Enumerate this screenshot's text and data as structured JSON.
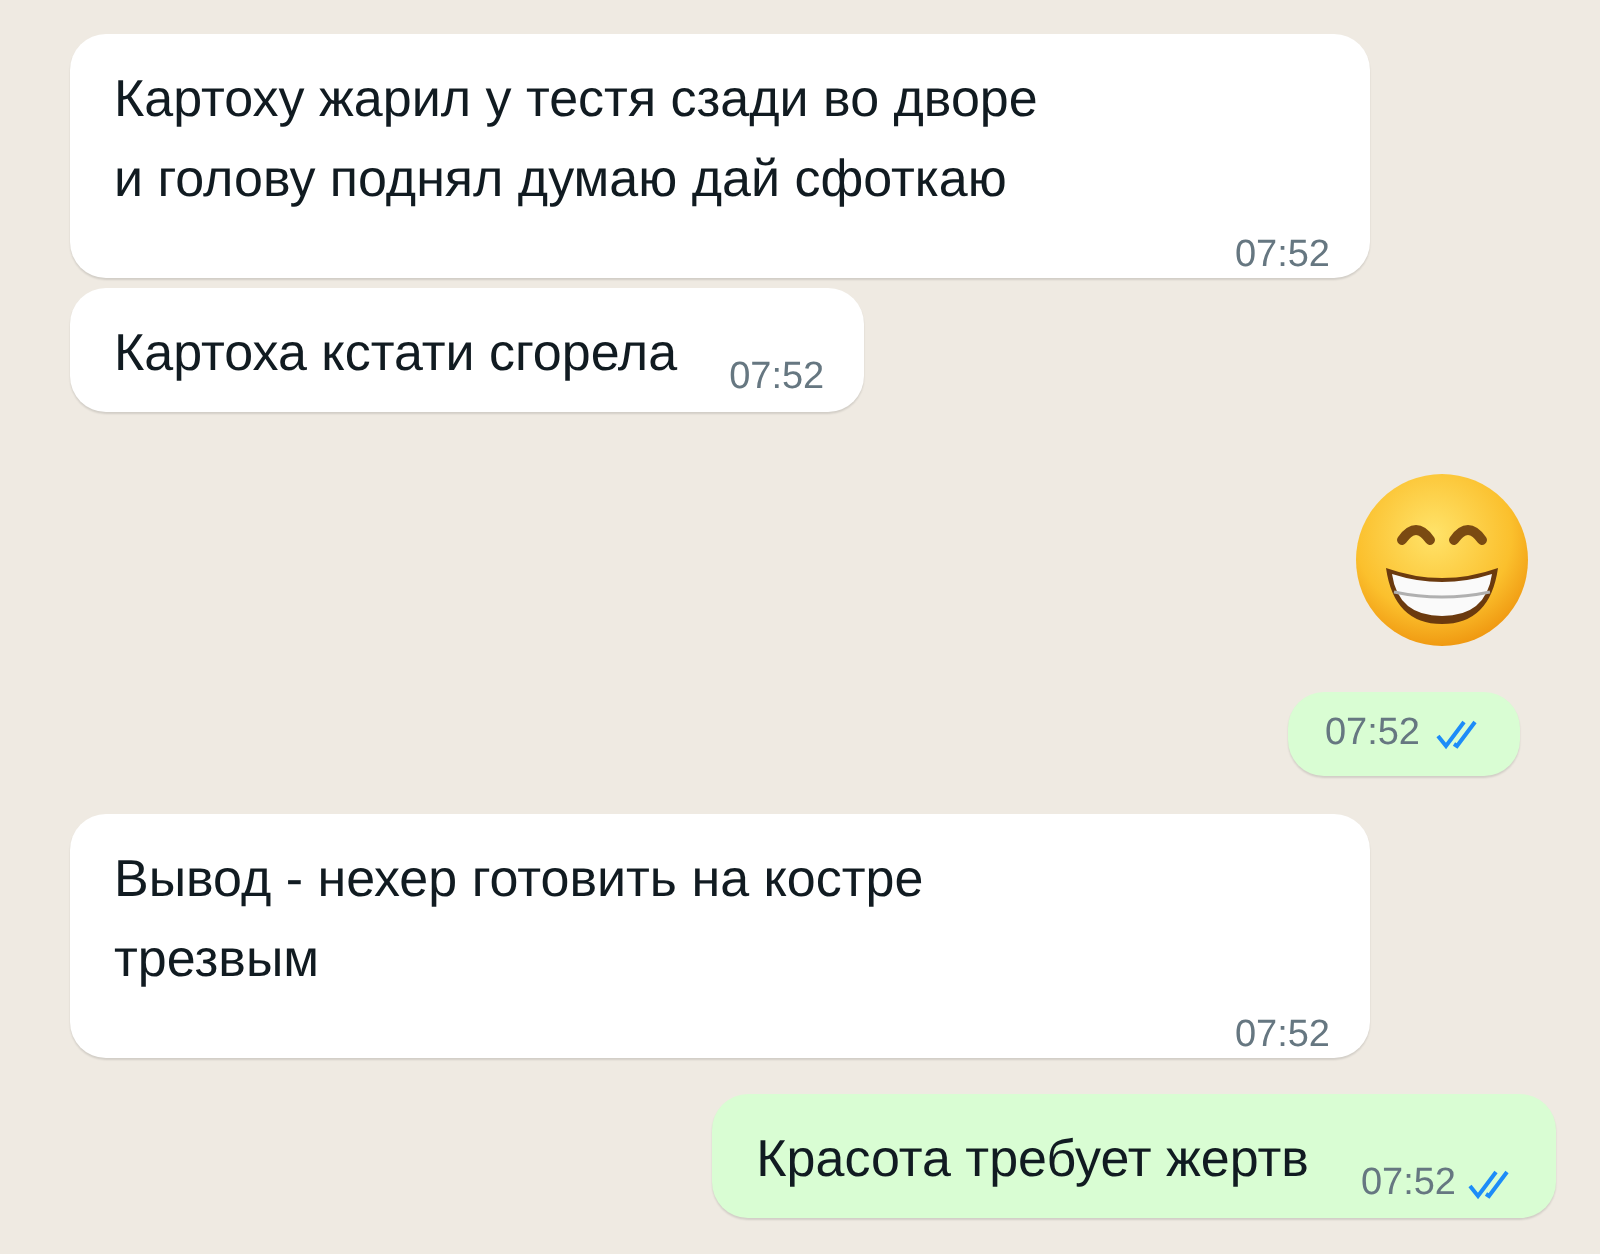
{
  "messages": [
    {
      "outgoing": false,
      "kind": "text",
      "text": "Картоху жарил у тестя сзади во дворе\nи голову поднял думаю дай сфоткаю",
      "time": "07:52"
    },
    {
      "outgoing": false,
      "kind": "text",
      "text": "Картоха кстати сгорела",
      "time": "07:52"
    },
    {
      "outgoing": true,
      "kind": "emoji",
      "time": "07:52",
      "read": true
    },
    {
      "outgoing": false,
      "kind": "text",
      "text": "Вывод - нехер готовить на костре\nтрезвым",
      "time": "07:52"
    },
    {
      "outgoing": true,
      "kind": "text",
      "text": "Красота требует жертв",
      "time": "07:52",
      "read": true
    }
  ]
}
